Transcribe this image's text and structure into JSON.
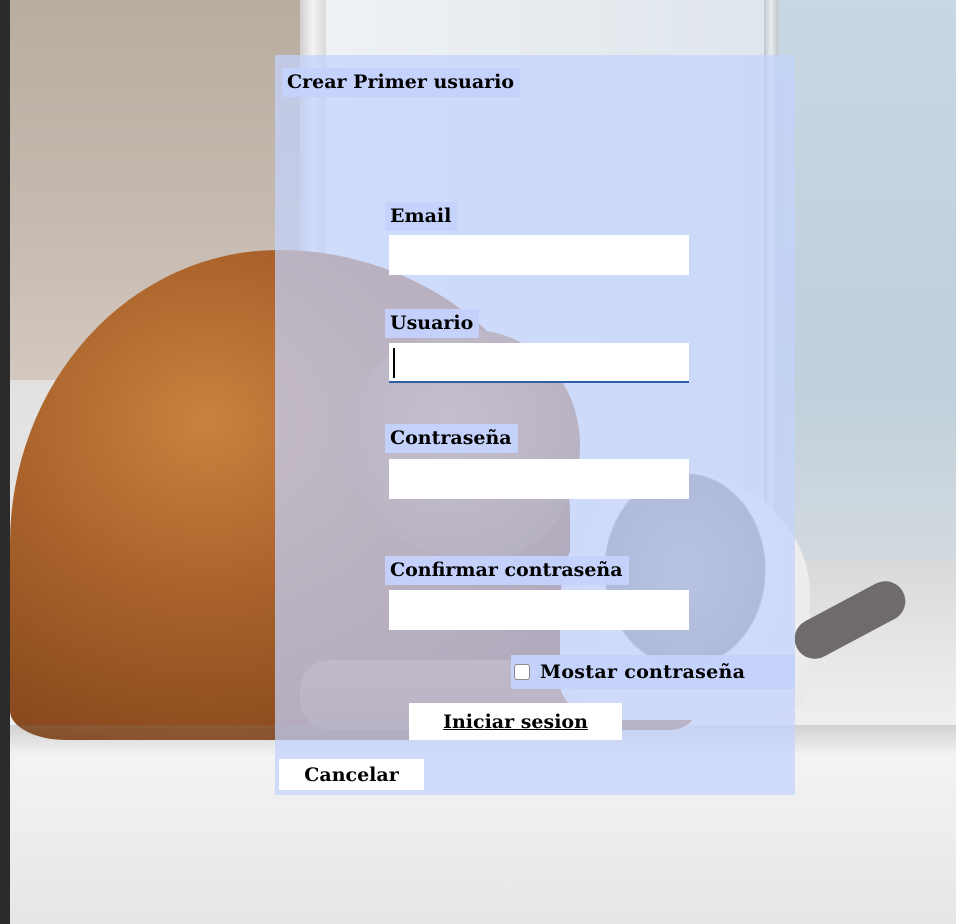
{
  "form": {
    "title": "Crear Primer usuario",
    "fields": {
      "email": {
        "label": "Email",
        "value": ""
      },
      "usuario": {
        "label": "Usuario",
        "value": ""
      },
      "contrasena": {
        "label": "Contraseña",
        "value": ""
      },
      "confirmar": {
        "label": "Confirmar contraseña",
        "value": ""
      }
    },
    "show_password": {
      "label": "Mostar contraseña",
      "checked": false
    },
    "login_button": "Iniciar sesion",
    "cancel_button": "Cancelar"
  },
  "colors": {
    "panel_overlay": "#c4d2fc",
    "focus_underline": "#2f5fa8",
    "field_background": "#ffffff"
  }
}
